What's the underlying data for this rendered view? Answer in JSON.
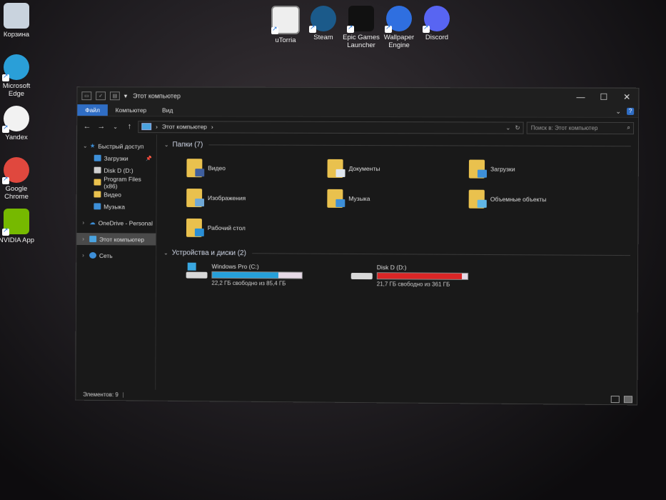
{
  "desktop_icons": [
    {
      "label": "Корзина",
      "icon": "recycle-bin-icon",
      "color": "#c9d3de"
    },
    {
      "label": "Microsoft Edge",
      "icon": "edge-icon",
      "color": "#2a9fd8"
    },
    {
      "label": "Yandex",
      "icon": "yandex-icon",
      "color": "#f2f2f2"
    },
    {
      "label": "Google Chrome",
      "icon": "chrome-icon",
      "color": "#e0483e"
    },
    {
      "label": "NVIDIA App",
      "icon": "nvidia-icon",
      "color": "#76b900"
    }
  ],
  "top_icons": [
    {
      "label": "uTorria",
      "icon": "utorria-icon",
      "color": "#eeeeee"
    },
    {
      "label": "Steam",
      "icon": "steam-icon",
      "color": "#1b5a8a"
    },
    {
      "label": "Epic Games Launcher",
      "icon": "epic-games-icon",
      "color": "#111111"
    },
    {
      "label": "Wallpaper Engine",
      "icon": "wallpaper-engine-icon",
      "color": "#2f6fe0"
    },
    {
      "label": "Discord",
      "icon": "discord-icon",
      "color": "#5865f2"
    }
  ],
  "window": {
    "title": "Этот компьютер",
    "tabs": [
      "Файл",
      "Компьютер",
      "Вид"
    ],
    "address_crumb": "Этот компьютер",
    "search_placeholder": "Поиск в: Этот компьютер",
    "accent": "#2f6dc4"
  },
  "nav": {
    "quick_access": "Быстрый доступ",
    "quick_items": [
      {
        "label": "Загрузки",
        "color": "#3d8fd8",
        "pinned": true
      },
      {
        "label": "Disk D (D:)",
        "color": "#cfcfcf",
        "pinned": false
      },
      {
        "label": "Program Files (x86)",
        "color": "#e9c14e",
        "pinned": false
      },
      {
        "label": "Видео",
        "color": "#e9c14e",
        "pinned": false
      },
      {
        "label": "Музыка",
        "color": "#3d8fd8",
        "pinned": false
      }
    ],
    "onedrive": "OneDrive - Personal",
    "this_pc": "Этот компьютер",
    "network": "Сеть"
  },
  "sections": {
    "folders_title": "Папки (7)",
    "drives_title": "Устройства и диски (2)"
  },
  "folders": [
    {
      "label": "Видео",
      "overlay": "#3f5f9e"
    },
    {
      "label": "Документы",
      "overlay": "#dfe6ef"
    },
    {
      "label": "Загрузки",
      "overlay": "#3d8fd8"
    },
    {
      "label": "Изображения",
      "overlay": "#6fa8d6"
    },
    {
      "label": "Музыка",
      "overlay": "#3d8fd8"
    },
    {
      "label": "Объемные объекты",
      "overlay": "#5fb6e6"
    },
    {
      "label": "Рабочий стол",
      "overlay": "#2a8fd6"
    }
  ],
  "drives": [
    {
      "name": "Windows Pro  (C:)",
      "free_text": "22,2 ГБ свободно из 85,4 ГБ",
      "used_fraction": 0.74,
      "bar_color": "#26a0da"
    },
    {
      "name": "Disk D (D:)",
      "free_text": "21,7 ГБ свободно из 361 ГБ",
      "used_fraction": 0.94,
      "bar_color": "#da2626"
    }
  ],
  "status": {
    "items_count": "Элементов: 9"
  }
}
